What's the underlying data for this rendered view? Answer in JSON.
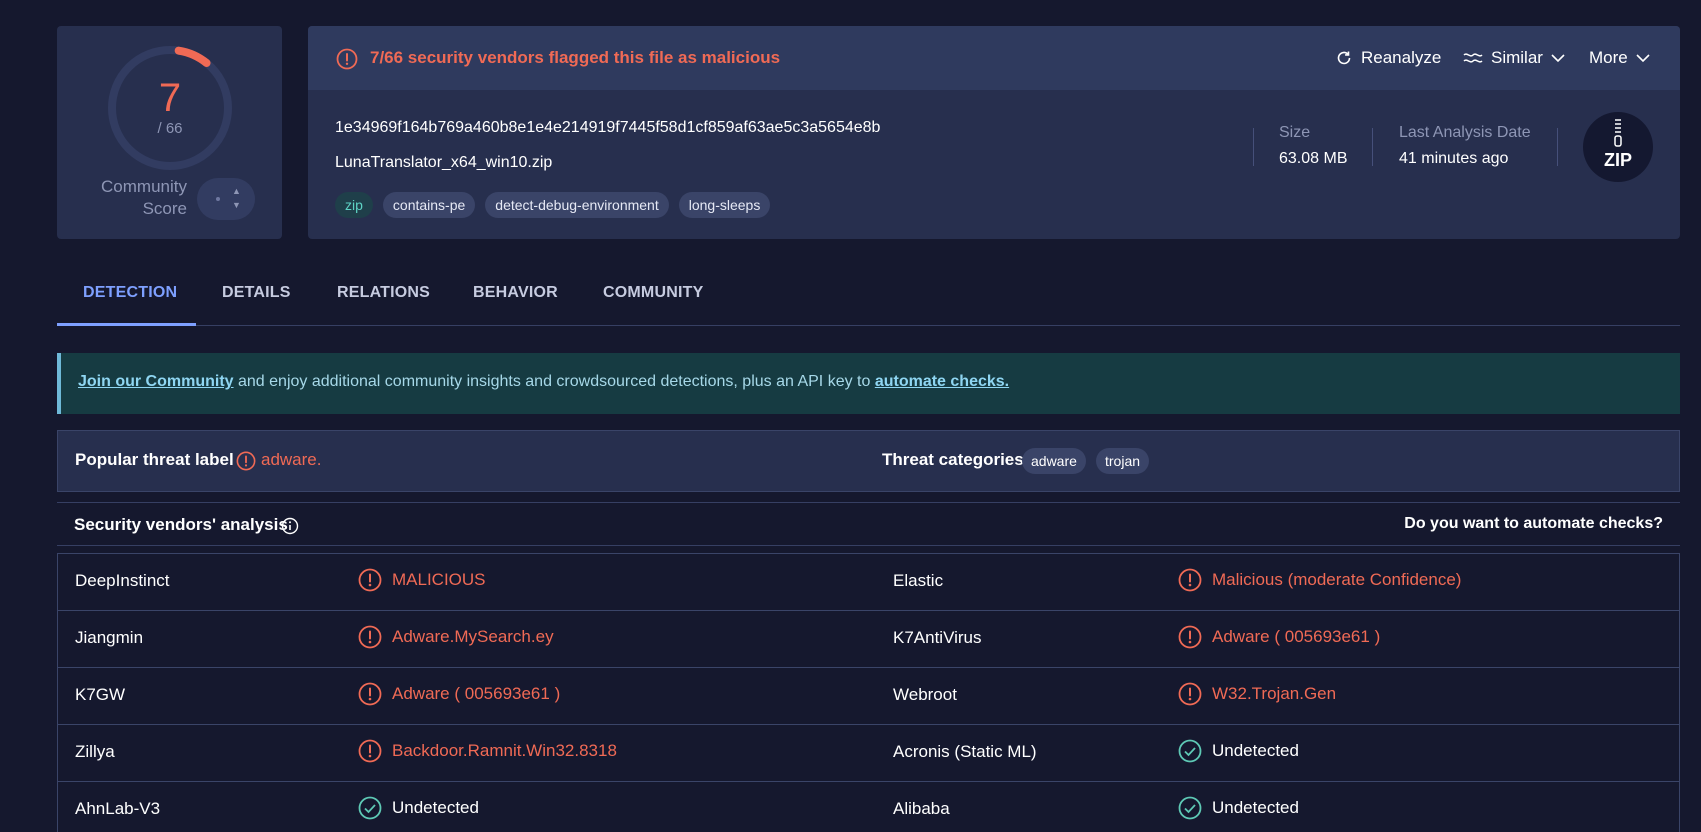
{
  "score": {
    "detections": "7",
    "total": "/ 66",
    "community_label": "Community Score",
    "fraction": 0.106
  },
  "header": {
    "alert": "7/66 security vendors flagged this file as malicious",
    "actions": {
      "reanalyze": "Reanalyze",
      "similar": "Similar",
      "more": "More"
    },
    "hash": "1e34969f164b769a460b8e1e4e214919f7445f58d1cf859af63ae5c3a5654e8b",
    "filename": "LunaTranslator_x64_win10.zip",
    "tags": [
      "zip",
      "contains-pe",
      "detect-debug-environment",
      "long-sleeps"
    ],
    "size_label": "Size",
    "size_value": "63.08 MB",
    "date_label": "Last Analysis Date",
    "date_value": "41 minutes ago",
    "file_type": "ZIP"
  },
  "tabs": [
    "DETECTION",
    "DETAILS",
    "RELATIONS",
    "BEHAVIOR",
    "COMMUNITY"
  ],
  "banner": {
    "link1": "Join our Community",
    "text": " and enjoy additional community insights and crowdsourced detections, plus an API key to ",
    "link2": "automate checks."
  },
  "threat": {
    "popular_label": "Popular threat label",
    "popular_value": "adware.",
    "categories_label": "Threat categories",
    "categories": [
      "adware",
      "trojan"
    ]
  },
  "vendors": {
    "title": "Security vendors' analysis",
    "automate": "Do you want to automate checks?",
    "rows": [
      {
        "left_name": "DeepInstinct",
        "left_result": "MALICIOUS",
        "left_status": "malicious",
        "right_name": "Elastic",
        "right_result": "Malicious (moderate Confidence)",
        "right_status": "malicious"
      },
      {
        "left_name": "Jiangmin",
        "left_result": "Adware.MySearch.ey",
        "left_status": "malicious",
        "right_name": "K7AntiVirus",
        "right_result": "Adware ( 005693e61 )",
        "right_status": "malicious"
      },
      {
        "left_name": "K7GW",
        "left_result": "Adware ( 005693e61 )",
        "left_status": "malicious",
        "right_name": "Webroot",
        "right_result": "W32.Trojan.Gen",
        "right_status": "malicious"
      },
      {
        "left_name": "Zillya",
        "left_result": "Backdoor.Ramnit.Win32.8318",
        "left_status": "malicious",
        "right_name": "Acronis (Static ML)",
        "right_result": "Undetected",
        "right_status": "undetected"
      },
      {
        "left_name": "AhnLab-V3",
        "left_result": "Undetected",
        "left_status": "undetected",
        "right_name": "Alibaba",
        "right_result": "Undetected",
        "right_status": "undetected"
      }
    ]
  },
  "colors": {
    "malicious": "#f06a55",
    "undetected": "#5ec9b5",
    "accent": "#7ea0ff"
  }
}
